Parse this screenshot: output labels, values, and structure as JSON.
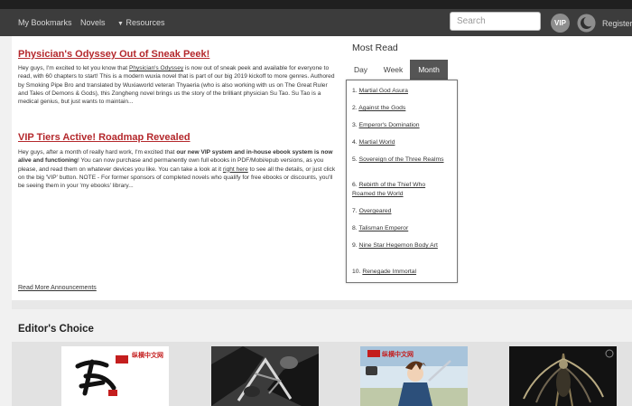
{
  "nav": {
    "bookmarks": "My Bookmarks",
    "novels": "Novels",
    "resources": "Resources",
    "search_placeholder": "Search",
    "vip": "VIP",
    "register": "Register"
  },
  "announcements": [
    {
      "title": "Physician's Odyssey Out of Sneak Peek!",
      "body_pre": "Hey guys, I'm excited to let you know that ",
      "body_link": "Physician's Odyssey",
      "body_post": " is now out of sneak peek and available for everyone to read, with 60 chapters to start!  This is a modern wuxia novel that is part of our big 2019 kickoff to more genres.  Authored by Smoking Pipe Bro and translated by Wuxiaworld veteran Thyaeria (who is also working with us on The Great Ruler and Tales of Demons & Gods), this Zongheng novel brings us the story of the brilliant physician Su Tao.  Su Tao is a medical genius, but just wants to maintain..."
    },
    {
      "title": "VIP Tiers Active! Roadmap Revealed",
      "body_pre": "Hey guys, after a month of really hard work, I'm excited that ",
      "body_bold": "our new VIP system and in-house ebook system is now alive and functioning",
      "body_mid": "!  You can now purchase and permanently own full ebooks in PDF/Mobi/epub versions, as you please, and read them on whatever devices you like.  You can take a look at it ",
      "body_link": "right here",
      "body_post": " to see all the details, or just click on the big 'VIP' button.  NOTE - For former sponsors of completed novels who qualify for free ebooks or discounts, you'll be seeing them in your 'my ebooks' library..."
    }
  ],
  "read_more": "Read More Announcements",
  "most_read": {
    "title": "Most Read",
    "tabs": [
      "Day",
      "Week",
      "Month"
    ],
    "active_tab": "Month",
    "items": [
      {
        "num": "1.",
        "title": "Martial God Asura"
      },
      {
        "num": "2.",
        "title": "Against the Gods"
      },
      {
        "num": "3.",
        "title": "Emperor's Domination"
      },
      {
        "num": "4.",
        "title": "Martial World"
      },
      {
        "num": "5.",
        "title": "Sovereign of the Three Realms"
      },
      {
        "num": "6.",
        "title": "Rebirth of the Thief Who Roamed the World"
      },
      {
        "num": "7.",
        "title": "Overgeared"
      },
      {
        "num": "8.",
        "title": "Talisman Emperor"
      },
      {
        "num": "9.",
        "title": "Nine Star Hegemon Body Art"
      },
      {
        "num": "10.",
        "title": "Renegade Immortal"
      }
    ]
  },
  "editors_choice": {
    "title": "Editor's Choice",
    "cover_publisher": "纵横中文网"
  },
  "colors": {
    "navbar": "#3c3c3c",
    "announcement_title": "#b4282c",
    "active_tab": "#555555",
    "page_bg": "#f1f1f1"
  },
  "icons": [
    "caret-down-icon",
    "moon-icon"
  ]
}
